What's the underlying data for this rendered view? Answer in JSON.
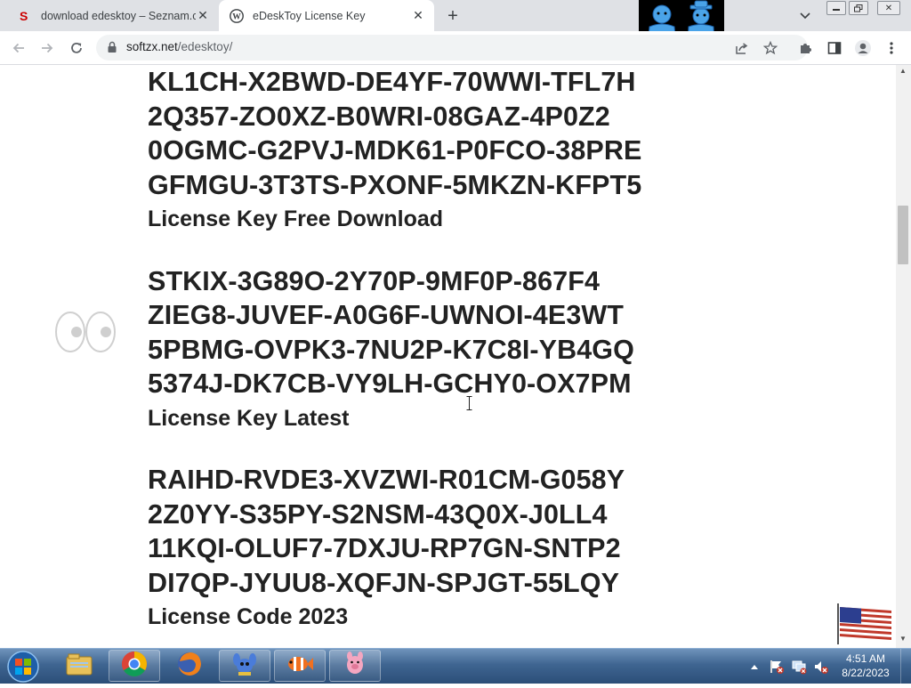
{
  "browser": {
    "tabs": [
      {
        "title": "download edesktoy – Seznam.cz",
        "favicon": "seznam-s-icon",
        "active": false
      },
      {
        "title": "eDeskToy License Key",
        "favicon": "wordpress-icon",
        "active": true
      }
    ],
    "url": {
      "host": "softzx.net",
      "path": "/edesktoy/"
    }
  },
  "page": {
    "sections": [
      {
        "keys": [
          "KL1CH-X2BWD-DE4YF-70WWI-TFL7H",
          "2Q357-ZO0XZ-B0WRI-08GAZ-4P0Z2",
          "0OGMC-G2PVJ-MDK61-P0FCO-38PRE",
          "GFMGU-3T3TS-PXONF-5MKZN-KFPT5"
        ],
        "heading": "License Key Free Download"
      },
      {
        "keys": [
          "STKIX-3G89O-2Y70P-9MF0P-867F4",
          "ZIEG8-JUVEF-A0G6F-UWNOI-4E3WT",
          "5PBMG-OVPK3-7NU2P-K7C8I-YB4GQ",
          "5374J-DK7CB-VY9LH-GCHY0-OX7PM"
        ],
        "heading": "License Key Latest"
      },
      {
        "keys": [
          "RAIHD-RVDE3-XVZWI-R01CM-G058Y",
          "2Z0YY-S35PY-S2NSM-43Q0X-J0LL4",
          "11KQI-OLUF7-7DXJU-RP7GN-SNTP2",
          "DI7QP-JYUU8-XQFJN-SPJGT-55LQY"
        ],
        "heading": "License Code 2023"
      }
    ]
  },
  "taskbar": {
    "pinned": [
      "windows-explorer-icon",
      "chrome-icon",
      "firefox-icon",
      "stitch-app-icon",
      "nemo-fish-app-icon",
      "piglet-app-icon"
    ],
    "clock": {
      "time": "4:51 AM",
      "date": "8/22/2023"
    }
  },
  "colors": {
    "text": "#222222",
    "tab_strip": "#dfe1e5",
    "omnibox": "#f1f3f4",
    "taskbar": "#3f6591"
  }
}
